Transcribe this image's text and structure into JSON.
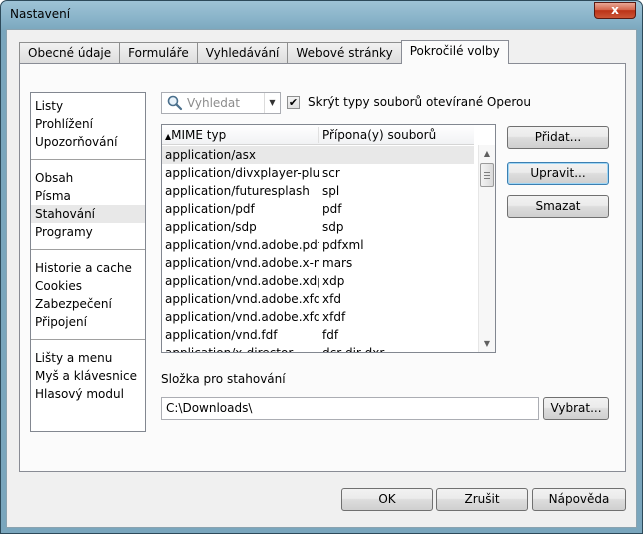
{
  "window": {
    "title": "Nastavení",
    "close_label": "x"
  },
  "tabs": [
    {
      "label": "Obecné údaje",
      "active": false
    },
    {
      "label": "Formuláře",
      "active": false
    },
    {
      "label": "Vyhledávání",
      "active": false
    },
    {
      "label": "Webové stránky",
      "active": false
    },
    {
      "label": "Pokročilé volby",
      "active": true
    }
  ],
  "categories": {
    "group1": [
      "Listy",
      "Prohlížení",
      "Upozorňování"
    ],
    "group2": [
      "Obsah",
      "Písma",
      "Stahování",
      "Programy"
    ],
    "group3": [
      "Historie a cache",
      "Cookies",
      "Zabezpečení",
      "Připojení"
    ],
    "group4": [
      "Lišty a menu",
      "Myš a klávesnice",
      "Hlasový modul"
    ],
    "selected": "Stahování"
  },
  "search": {
    "placeholder": "Vyhledat",
    "icon": "magnifier-icon"
  },
  "hide_types": {
    "label": "Skrýt typy souborů otevírané Operou",
    "checked": true
  },
  "mime_table": {
    "columns": [
      "MIME typ",
      "Přípona(y) souborů"
    ],
    "sort_indicator": "▲",
    "rows": [
      [
        "application/asx",
        ""
      ],
      [
        "application/divxplayer-plug...",
        "scr"
      ],
      [
        "application/futuresplash",
        "spl"
      ],
      [
        "application/pdf",
        "pdf"
      ],
      [
        "application/sdp",
        "sdp"
      ],
      [
        "application/vnd.adobe.pdfx...",
        "pdfxml"
      ],
      [
        "application/vnd.adobe.x-m...",
        "mars"
      ],
      [
        "application/vnd.adobe.xdp...",
        "xdp"
      ],
      [
        "application/vnd.adobe.xfd...",
        "xfd"
      ],
      [
        "application/vnd.adobe.xfdf",
        "xfdf"
      ],
      [
        "application/vnd.fdf",
        "fdf"
      ],
      [
        "application/x-director",
        "dcr dir dxr"
      ]
    ],
    "selected_row": 0
  },
  "side_buttons": {
    "add": "Přidat...",
    "edit": "Upravit...",
    "delete": "Smazat"
  },
  "download_folder": {
    "label": "Složka pro stahování",
    "value": "C:\\Downloads\\",
    "browse": "Vybrat..."
  },
  "footer": {
    "ok": "OK",
    "cancel": "Zrušit",
    "help": "Nápověda"
  }
}
